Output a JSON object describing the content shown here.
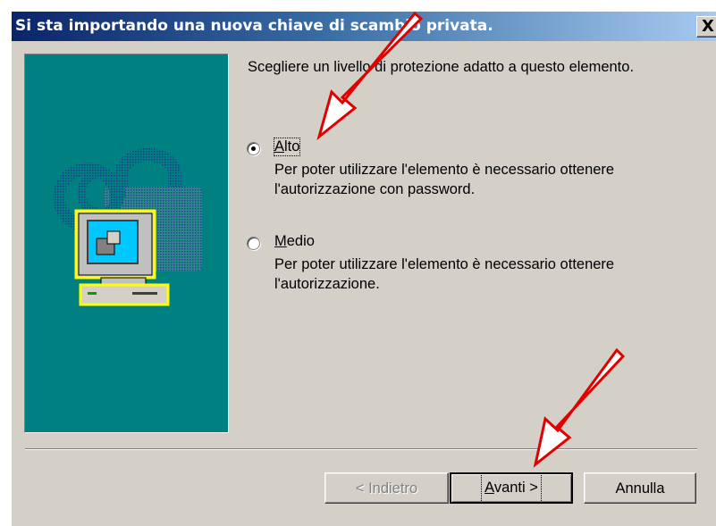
{
  "window": {
    "title": "Si sta importando una nuova chiave di scambio privata.",
    "close_glyph": "X"
  },
  "instruction": "Scegliere un livello di protezione adatto a questo elemento.",
  "options": [
    {
      "label_mnemonic": "A",
      "label_rest": "lto",
      "description": "Per poter utilizzare l'elemento è necessario ottenere l'autorizzazione con password.",
      "checked": true
    },
    {
      "label_mnemonic": "M",
      "label_rest": "edio",
      "description": "Per poter utilizzare l'elemento è necessario ottenere l'autorizzazione.",
      "checked": false
    }
  ],
  "buttons": {
    "back": "< Indietro",
    "next_mnemonic": "A",
    "next_rest": "vanti >",
    "cancel": "Annulla"
  },
  "colors": {
    "title_start": "#0a246a",
    "title_end": "#a6caf0",
    "panel": "#008080",
    "dialog": "#d4d0c8",
    "annotation_arrow": "#e00000"
  },
  "icons": {
    "illustration": "padlock-computer-icon",
    "annotation": "red-arrow"
  }
}
